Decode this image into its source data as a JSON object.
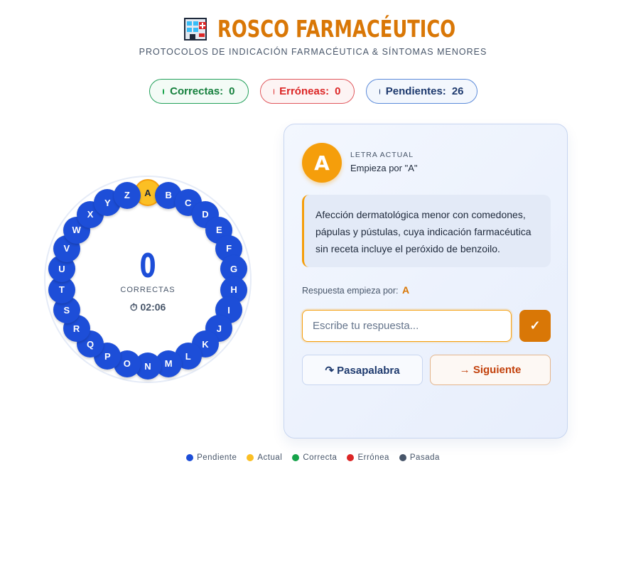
{
  "header": {
    "icon": "pharmacy-building-icon",
    "title": "ROSCO FARMACÉUTICO",
    "subtitle": "PROTOCOLOS DE INDICACIÓN FARMACÉUTICA & SÍNTOMAS MENORES"
  },
  "scores": {
    "correct_label": "Correctas:",
    "correct_value": "0",
    "wrong_label": "Erróneas:",
    "wrong_value": "0",
    "pending_label": "Pendientes:",
    "pending_value": "26"
  },
  "rosco": {
    "letters": [
      "A",
      "B",
      "C",
      "D",
      "E",
      "F",
      "G",
      "H",
      "I",
      "J",
      "K",
      "L",
      "M",
      "N",
      "O",
      "P",
      "Q",
      "R",
      "S",
      "T",
      "U",
      "V",
      "W",
      "X",
      "Y",
      "Z"
    ],
    "current_letter": "A",
    "count": "0",
    "count_label": "CORRECTAS",
    "timer": "⏱ 02:06"
  },
  "card": {
    "badge_letter": "A",
    "letter_label": "LETRA ACTUAL",
    "letter_rule": "Empieza por \"A\"",
    "question": "Afección dermatológica menor con comedones, pápulas y pústulas, cuya indicación farmacéutica sin receta incluye el peróxido de benzoilo.",
    "hint_label": "Respuesta empieza por:",
    "hint_letter": "A",
    "answer_placeholder": "Escribe tu respuesta...",
    "answer_value": "",
    "submit_label": "✓",
    "pass_label": "↷ Pasapalabra",
    "next_label": "→ Siguiente"
  },
  "legend": [
    {
      "label": "Pendiente",
      "color": "#1d4ed8"
    },
    {
      "label": "Actual",
      "color": "#fbbf24"
    },
    {
      "label": "Correcta",
      "color": "#16a34a"
    },
    {
      "label": "Errónea",
      "color": "#dc2626"
    },
    {
      "label": "Pasada",
      "color": "#475569"
    }
  ],
  "colors": {
    "accent": "#d97706",
    "pending": "#1d4ed8",
    "current": "#fbbf24"
  }
}
